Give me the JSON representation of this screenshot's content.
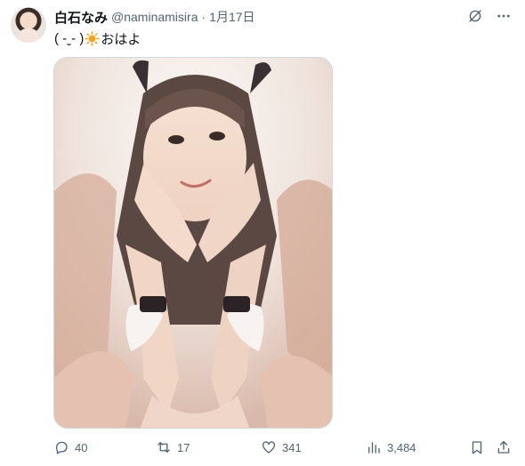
{
  "tweet": {
    "display_name": "白石なみ",
    "handle": "@naminamisira",
    "separator": "·",
    "date": "1月17日",
    "text_prefix": "( -ˬ- )",
    "emoji_name": "sun-emoji",
    "text_suffix": "おはよ"
  },
  "metrics": {
    "replies": "40",
    "retweets": "17",
    "likes": "341",
    "views": "3,484"
  },
  "icons": {
    "grok": "grok-icon",
    "more": "more-icon",
    "reply": "reply-icon",
    "retweet": "retweet-icon",
    "like": "heart-icon",
    "views": "views-icon",
    "bookmark": "bookmark-icon",
    "share": "share-icon"
  },
  "colors": {
    "text_primary": "#0f1419",
    "text_secondary": "#536471",
    "border": "#cfd9de",
    "sun": "#f9a11b"
  }
}
